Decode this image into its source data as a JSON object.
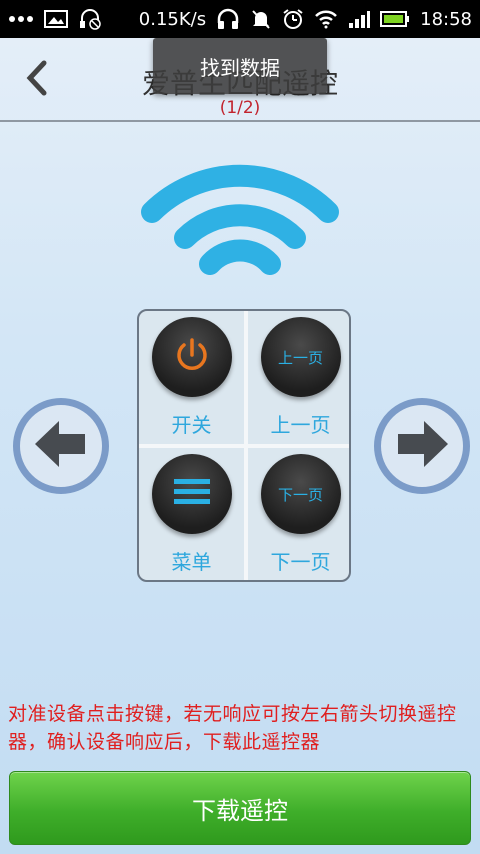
{
  "status_bar": {
    "left_icons": [
      "more-icon",
      "image-icon",
      "headset-muted-icon"
    ],
    "net_speed": "0.15K/s",
    "right_icons": [
      "headphone-icon",
      "mute-icon",
      "alarm-icon",
      "wifi-icon",
      "signal-icon",
      "battery-icon"
    ],
    "time": "18:58"
  },
  "header": {
    "title": "爱普生匹配遥控",
    "counter": "(1/2)"
  },
  "toast": "找到数据",
  "keys": [
    {
      "icon": "power-icon",
      "label": "开关"
    },
    {
      "icon_text": "上一页",
      "label": "上一页"
    },
    {
      "icon": "menu-icon",
      "label": "菜单"
    },
    {
      "icon_text": "下一页",
      "label": "下一页"
    }
  ],
  "hint": "对准设备点击按键，若无响应可按左右箭头切换遥控器，确认设备响应后，下载此遥控器",
  "download_button": "下载遥控",
  "colors": {
    "accent_blue": "#2ea7dd",
    "hint_red": "#e01f1f",
    "button_green": "#3fae2a",
    "power_orange": "#e8761f"
  }
}
